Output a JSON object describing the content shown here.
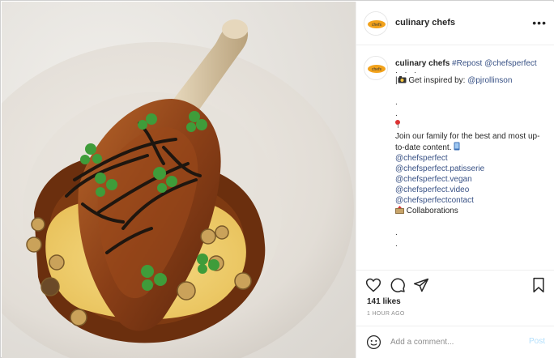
{
  "header": {
    "username": "culinary chefs",
    "avatar_icon": "culinary-chefs-logo"
  },
  "caption": {
    "username": "culinary chefs",
    "repost_tag": "#Repost",
    "repost_user": "@chefsperfect",
    "inspired_text": "Get inspired by: ",
    "inspired_user": "@pjrollinson",
    "join_text": "Join our family for the best and most up-to-date content.",
    "links": [
      "@chefsperfect",
      "@chefsperfect.patisserie",
      "@chefsperfect.vegan",
      "@chefsperfect.video",
      "@chefsperfectcontact"
    ],
    "collab_text": "Collaborations"
  },
  "actions": {
    "likes": "141 likes",
    "time": "1 HOUR AGO"
  },
  "comment": {
    "placeholder": "Add a comment...",
    "post_label": "Post"
  },
  "colors": {
    "link": "#385185",
    "post_disabled": "#b2dffc"
  }
}
